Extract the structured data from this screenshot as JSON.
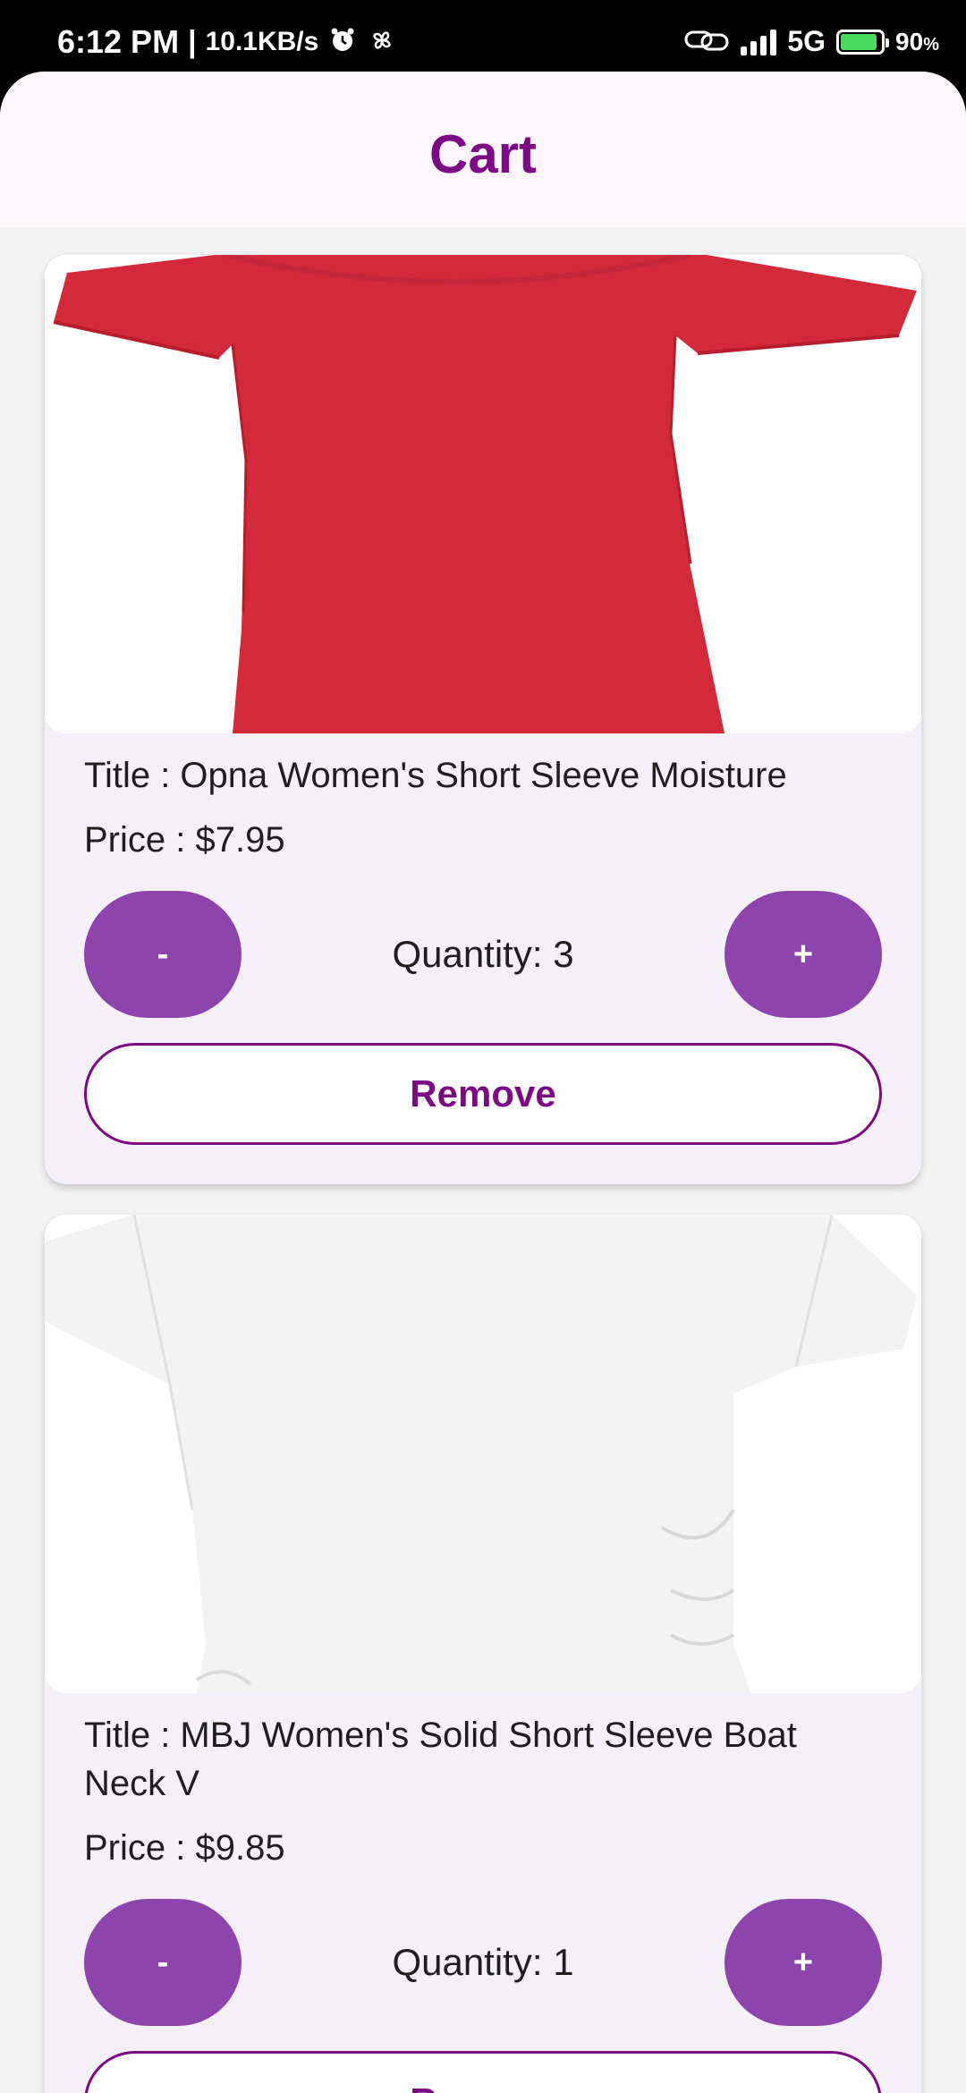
{
  "status_bar": {
    "time": "6:12 PM",
    "network_speed": "10.1KB/s",
    "network_type": "5G",
    "battery_percent": "90",
    "battery_unit": "%",
    "battery_level": 0.9,
    "icons": [
      "alarm-icon",
      "pinwheel-icon",
      "link-icon",
      "signal-icon",
      "battery-icon"
    ]
  },
  "header": {
    "title": "Cart",
    "title_color": "#7b0a84"
  },
  "cart": {
    "items": [
      {
        "title": "Title : Opna Women's Short Sleeve Moisture",
        "price": "Price : $7.95",
        "quantity": "Quantity: 3",
        "minus_label": "-",
        "plus_label": "+",
        "remove_label": "Remove",
        "image_color": "#d22a3a"
      },
      {
        "title": "Title : MBJ Women's Solid Short Sleeve Boat Neck V",
        "price": "Price : $9.85",
        "quantity": "Quantity: 1",
        "minus_label": "-",
        "plus_label": "+",
        "remove_label": "Remove",
        "image_color": "#f4f4f4"
      }
    ]
  },
  "colors": {
    "accent": "#8e44ad",
    "brand": "#7b0a84",
    "card_bg": "#f5f0f7"
  }
}
